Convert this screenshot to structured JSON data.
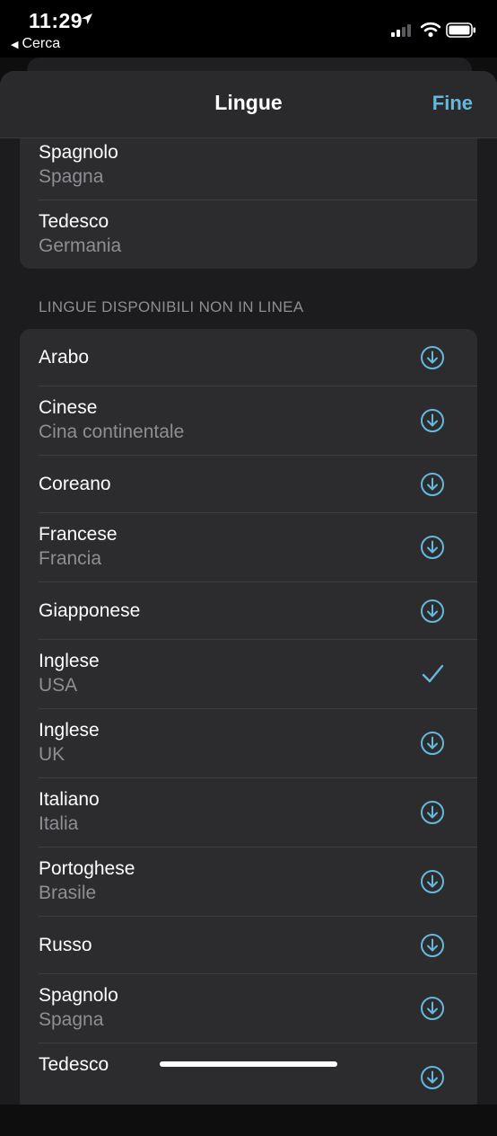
{
  "status_bar": {
    "time": "11:29",
    "back_label": "Cerca"
  },
  "sheet": {
    "title": "Lingue",
    "done_label": "Fine"
  },
  "installed_languages": [
    {
      "name": "Spagnolo",
      "region": "Spagna"
    },
    {
      "name": "Tedesco",
      "region": "Germania"
    }
  ],
  "available_section_header": "LINGUE DISPONIBILI NON IN LINEA",
  "available_languages": [
    {
      "name": "Arabo",
      "region": "",
      "status": "download"
    },
    {
      "name": "Cinese",
      "region": "Cina continentale",
      "status": "download"
    },
    {
      "name": "Coreano",
      "region": "",
      "status": "download"
    },
    {
      "name": "Francese",
      "region": "Francia",
      "status": "download"
    },
    {
      "name": "Giapponese",
      "region": "",
      "status": "download"
    },
    {
      "name": "Inglese",
      "region": "USA",
      "status": "downloaded"
    },
    {
      "name": "Inglese",
      "region": "UK",
      "status": "download"
    },
    {
      "name": "Italiano",
      "region": "Italia",
      "status": "download"
    },
    {
      "name": "Portoghese",
      "region": "Brasile",
      "status": "download"
    },
    {
      "name": "Russo",
      "region": "",
      "status": "download"
    },
    {
      "name": "Spagnolo",
      "region": "Spagna",
      "status": "download"
    },
    {
      "name": "Tedesco",
      "region": "",
      "status": "download"
    }
  ],
  "colors": {
    "accent": "#64b9dc",
    "sheet_bg": "#1c1c1e",
    "cell_bg": "#2c2c2e",
    "secondary_text": "#8e8e93"
  }
}
